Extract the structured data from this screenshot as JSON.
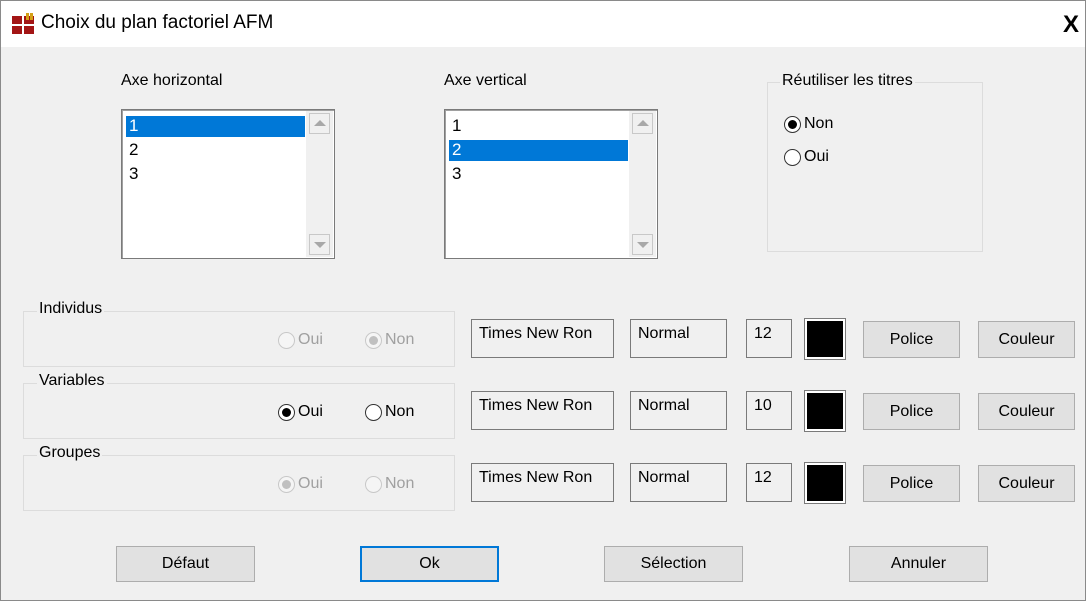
{
  "window": {
    "title": "Choix du plan factoriel AFM",
    "close_label": "X"
  },
  "axes": {
    "horizontal": {
      "label": "Axe horizontal",
      "items": [
        "1",
        "2",
        "3"
      ],
      "selected": "1"
    },
    "vertical": {
      "label": "Axe vertical",
      "items": [
        "1",
        "2",
        "3"
      ],
      "selected": "2"
    }
  },
  "reuse_titles": {
    "label": "Réutiliser les titres",
    "options": [
      {
        "label": "Non",
        "checked": true
      },
      {
        "label": "Oui",
        "checked": false
      }
    ]
  },
  "rows": [
    {
      "group": "Individus",
      "enabled": false,
      "oui_label": "Oui",
      "non_label": "Non",
      "selected": "Non",
      "font": "Times New Ron",
      "style": "Normal",
      "size": "12",
      "color": "#000000",
      "police_label": "Police",
      "couleur_label": "Couleur"
    },
    {
      "group": "Variables",
      "enabled": true,
      "oui_label": "Oui",
      "non_label": "Non",
      "selected": "Oui",
      "font": "Times New Ron",
      "style": "Normal",
      "size": "10",
      "color": "#000000",
      "police_label": "Police",
      "couleur_label": "Couleur"
    },
    {
      "group": "Groupes",
      "enabled": false,
      "oui_label": "Oui",
      "non_label": "Non",
      "selected": "Oui",
      "font": "Times New Ron",
      "style": "Normal",
      "size": "12",
      "color": "#000000",
      "police_label": "Police",
      "couleur_label": "Couleur"
    }
  ],
  "buttons": {
    "default": "Défaut",
    "ok": "Ok",
    "selection": "Sélection",
    "cancel": "Annuler"
  },
  "colors": {
    "selection": "#0078d7",
    "dialog_bg": "#f0f0f0",
    "app_icon_primary": "#a31515",
    "app_icon_secondary": "#d4a017"
  }
}
